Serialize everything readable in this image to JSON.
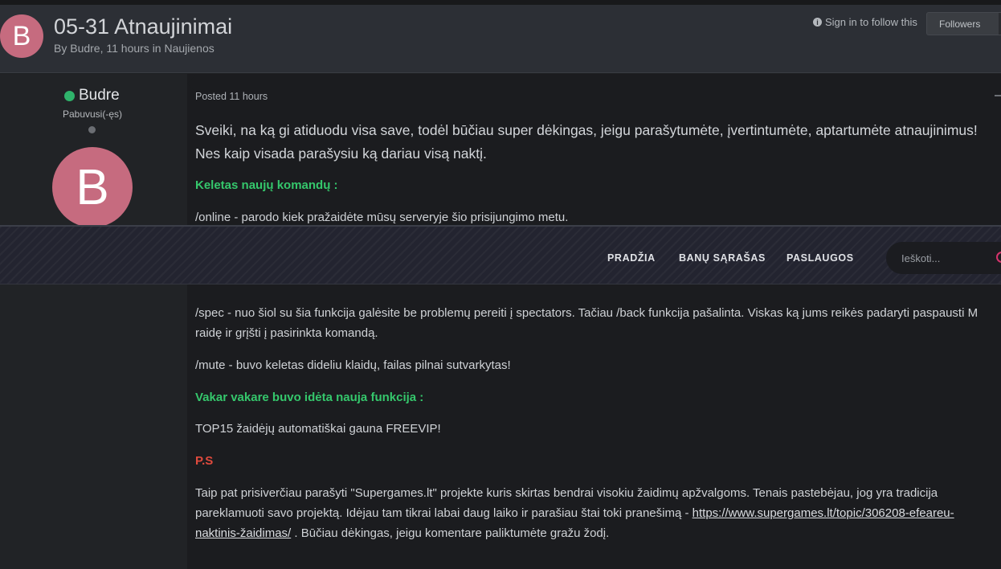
{
  "header": {
    "avatar_letter": "B",
    "title": "05-31 Atnaujinimai",
    "byline": "By Budre, 11 hours in Naujienos",
    "sign_in": "Sign in to follow this",
    "followers_label": "Followers"
  },
  "author": {
    "name": "Budre",
    "group": "Pabuvusi(-ęs)",
    "avatar_letter": "B"
  },
  "post": {
    "posted": "Posted 11 hours",
    "lead": "Sveiki, na ką gi atiduodu visa save, todėl būčiau super dėkingas, jeigu parašytumėte, įvertintumėte, aptartumėte atnaujinimus! Nes kaip visada parašysiu ką dariau visą naktį.",
    "heading_commands": "Keletas naujų komandų  :",
    "cmd_online": "/online - parodo kiek pražaidėte mūsų serveryje šio prisijungimo metu.",
    "cmd_spec": "/spec - nuo šiol su šia funkcija galėsite be problemų pereiti į spectators. Tačiau /back funkcija pašalinta. Viskas ką jums reikės padaryti paspausti M raidę ir grįšti į pasirinkta komandą.",
    "cmd_mute": "/mute - buvo keletas dideliu klaidų, failas pilnai sutvarkytas!",
    "heading_feature": "Vakar vakare buvo idėta nauja funkcija :",
    "top15": "TOP15 žaidėjų automatiškai gauna FREEVIP!",
    "ps": "P.S",
    "closing_before": "Taip pat prisiverčiau parašyti \"Supergames.lt\" projekte kuris skirtas bendrai visokiu žaidimų apžvalgoms. Tenais pastebėjau, jog yra tradicija pareklamuoti savo projektą. Idėjau tam tikrai labai daug laiko ir parašiau štai toki pranešimą - ",
    "closing_link": "https://www.supergames.lt/topic/306208-efeareu-naktinis-žaidimas/",
    "closing_after": " . Būčiau dėkingas, jeigu komentare paliktumėte gražu žodį."
  },
  "nav": {
    "items": [
      "PRADŽIA",
      "BANŲ SĄRAŠAS",
      "PASLAUGOS"
    ],
    "search_placeholder": "Ieškoti..."
  },
  "colors": {
    "accent_green": "#35c76c",
    "accent_red": "#e04a3d",
    "avatar": "#c66b7f"
  }
}
